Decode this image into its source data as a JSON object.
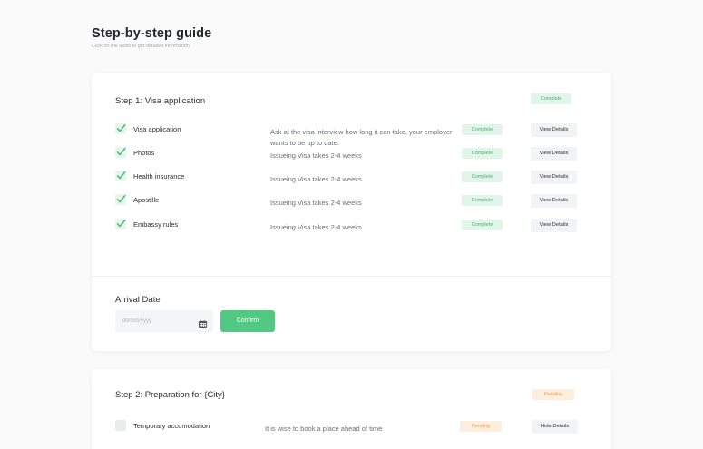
{
  "header": {
    "title": "Step-by-step guide",
    "subtitle": "Click on the tasks to get detailed information."
  },
  "step1": {
    "title": "Step 1: Visa application",
    "status": "Complete",
    "tasks": [
      {
        "name": "Visa application",
        "description": "Ask at the visa interview how long it can take, your employer wants to be up to date.",
        "status": "Complete",
        "action": "View Details"
      },
      {
        "name": "Photos",
        "description": "Issueing Visa takes 2-4 weeks",
        "status": "Complete",
        "action": "View Details"
      },
      {
        "name": "Health insurance",
        "description": "Issueing Visa takes 2-4 weeks",
        "status": "Complete",
        "action": "View Details"
      },
      {
        "name": "Apostille",
        "description": "Issueing Visa takes 2-4 weeks",
        "status": "Complete",
        "action": "View Details"
      },
      {
        "name": "Embassy rules",
        "description": "Issueing Visa takes 2-4 weeks",
        "status": "Complete",
        "action": "View Details"
      }
    ],
    "arrival": {
      "label": "Arrival Date",
      "placeholder": "dd/mm/yyyy",
      "confirm_label": "Confirm"
    }
  },
  "step2": {
    "title": "Step 2: Preparation for {City}",
    "status": "Pending",
    "tasks": [
      {
        "name": "Temporary accomodation",
        "description": "It is wise to book a place ahead of time",
        "status": "Pending",
        "action": "Hide Details"
      }
    ]
  },
  "icons": {
    "check": "checkmark-icon",
    "calendar": "calendar-icon"
  },
  "colors": {
    "complete_bg": "#e1f5e8",
    "complete_text": "#4caf75",
    "pending_bg": "#fdeede",
    "pending_text": "#f0a050",
    "confirm_button": "#52c983"
  }
}
